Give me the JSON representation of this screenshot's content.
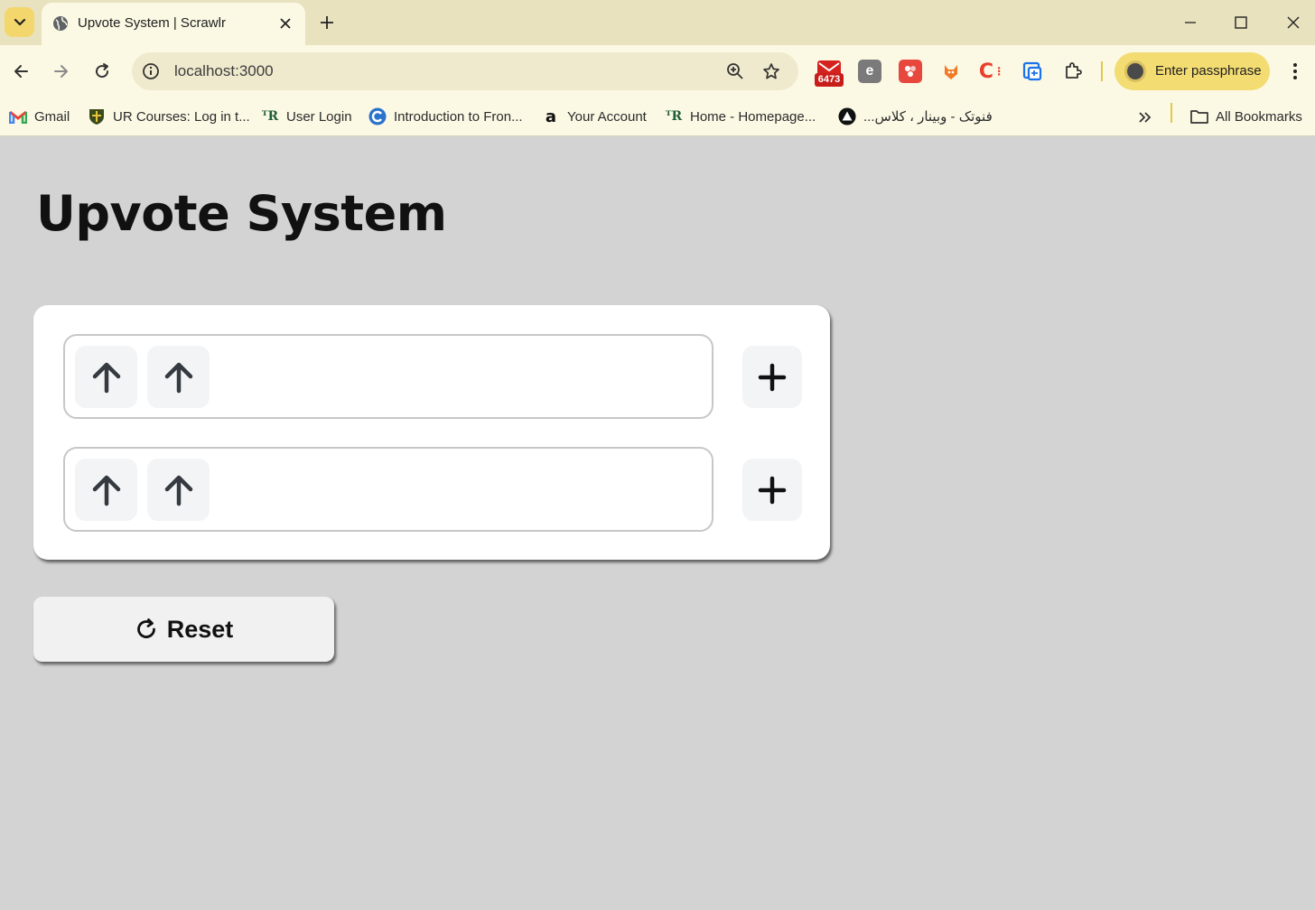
{
  "browser": {
    "tab": {
      "title": "Upvote System | Scrawlr"
    },
    "address_bar": {
      "url": "localhost:3000"
    },
    "extensions": [
      {
        "name": "mail-extension",
        "badge": "6473",
        "color": "#d4231f"
      },
      {
        "name": "e-extension",
        "color": "#6f6f6f"
      },
      {
        "name": "puzzle-extension",
        "color": "#e8473e"
      },
      {
        "name": "fox-extension",
        "color": "#f07b24"
      },
      {
        "name": "c-extension",
        "color": "#e8402b"
      },
      {
        "name": "translate-extension",
        "color": "#1a73e8"
      }
    ],
    "profile": {
      "label": "Enter passphrase"
    },
    "bookmarks": [
      {
        "label": "Gmail",
        "icon": "gmail-icon"
      },
      {
        "label": "UR Courses: Log in t...",
        "icon": "shield-icon"
      },
      {
        "label": "User Login",
        "icon": "ur-icon"
      },
      {
        "label": "Introduction to Fron...",
        "icon": "coursera-icon"
      },
      {
        "label": "Your Account",
        "icon": "amazon-icon"
      },
      {
        "label": "Home - Homepage...",
        "icon": "ur-icon"
      },
      {
        "label": "فنوتک - وبینار ، کلاس...",
        "icon": "triangle-icon"
      }
    ],
    "all_bookmarks": "All Bookmarks"
  },
  "page": {
    "title": "Upvote System",
    "lists": [
      {
        "upvotes": 2
      },
      {
        "upvotes": 2
      }
    ],
    "reset_label": "Reset"
  },
  "colors": {
    "page_background": "#d3d3d3",
    "card_background": "#ffffff",
    "button_background": "#f3f4f6",
    "arrow_color": "#343a40",
    "chrome_background": "#fbf8e4",
    "tabstrip_background": "#e8e2bf",
    "profile_pill": "#f3dc72"
  }
}
